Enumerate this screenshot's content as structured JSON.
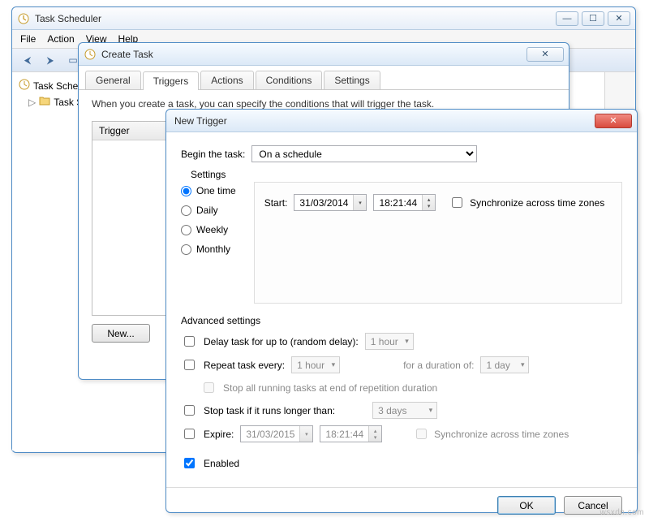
{
  "main": {
    "title": "Task Scheduler",
    "menu": [
      "File",
      "Action",
      "View",
      "Help"
    ],
    "tree": {
      "root": "Task Scheduler (Local)",
      "child": "Task Scheduler Library"
    }
  },
  "create": {
    "title": "Create Task",
    "tabs": [
      "General",
      "Triggers",
      "Actions",
      "Conditions",
      "Settings"
    ],
    "desc": "When you create a task, you can specify the conditions that will trigger the task.",
    "list_header": "Trigger",
    "buttons": {
      "new": "New..."
    }
  },
  "trigger": {
    "title": "New Trigger",
    "begin_label": "Begin the task:",
    "begin_value": "On a schedule",
    "settings_label": "Settings",
    "schedule_options": {
      "one": "One time",
      "daily": "Daily",
      "weekly": "Weekly",
      "monthly": "Monthly"
    },
    "start_label": "Start:",
    "start_date": "31/03/2014",
    "start_time": "18:21:44",
    "sync_tz": "Synchronize across time zones",
    "adv_label": "Advanced settings",
    "delay_label": "Delay task for up to (random delay):",
    "delay_value": "1 hour",
    "repeat_label": "Repeat task every:",
    "repeat_value": "1 hour",
    "duration_label": "for a duration of:",
    "duration_value": "1 day",
    "stop_repeat_label": "Stop all running tasks at end of repetition duration",
    "stop_long_label": "Stop task if it runs longer than:",
    "stop_long_value": "3 days",
    "expire_label": "Expire:",
    "expire_date": "31/03/2015",
    "expire_time": "18:21:44",
    "expire_sync": "Synchronize across time zones",
    "enabled_label": "Enabled",
    "ok": "OK",
    "cancel": "Cancel"
  },
  "watermark": "wsxdn.com"
}
